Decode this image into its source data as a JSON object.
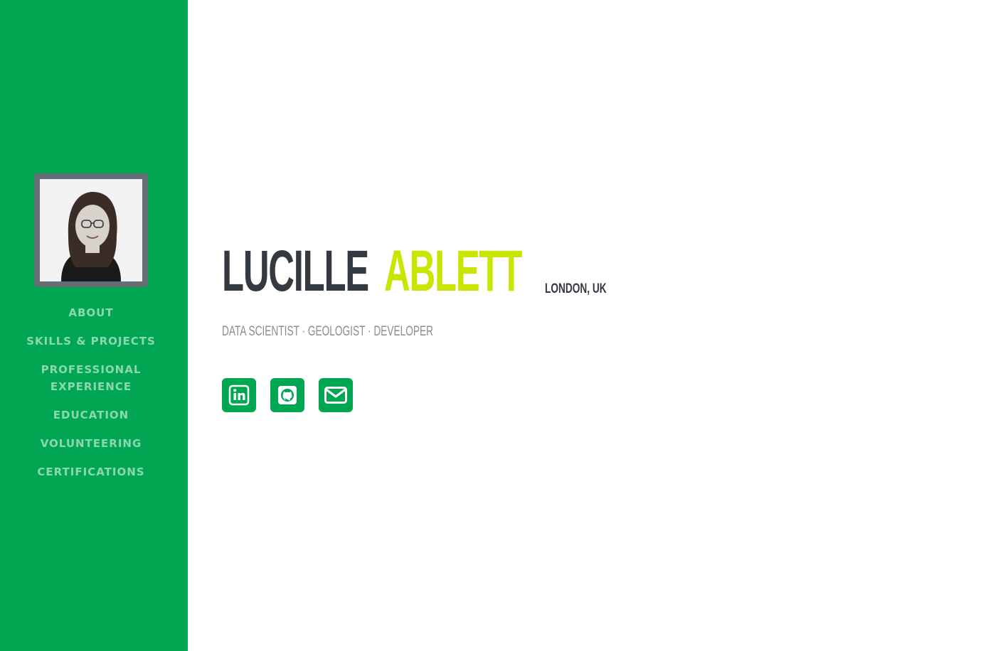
{
  "profile": {
    "first_name": "Lucille",
    "last_name": "Ablett",
    "location": "London, UK",
    "subtitle": "Data Scientist · Geologist · Developer"
  },
  "nav": {
    "items": [
      {
        "label": "About"
      },
      {
        "label": "Skills & Projects"
      },
      {
        "label": "Professional Experience"
      },
      {
        "label": "Education"
      },
      {
        "label": "Volunteering"
      },
      {
        "label": "Certifications"
      }
    ]
  },
  "socials": [
    {
      "icon": "linkedin-icon"
    },
    {
      "icon": "github-icon"
    },
    {
      "icon": "envelope-icon"
    }
  ],
  "colors": {
    "sidebar": "#00a651",
    "accent": "#c8e600",
    "heading": "#343a40",
    "muted": "#868e96"
  }
}
